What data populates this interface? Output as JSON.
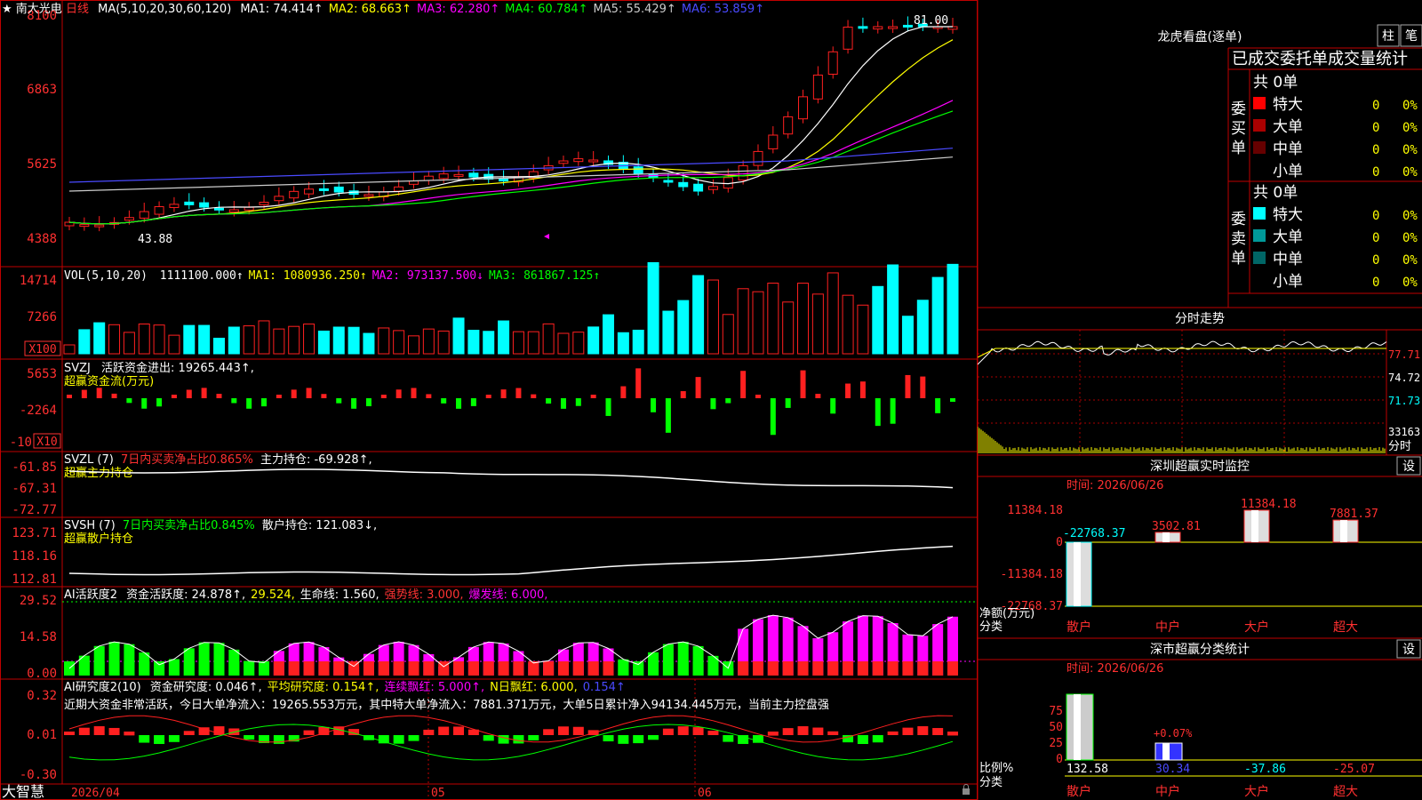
{
  "stock": {
    "star": "★",
    "name": "南大光电",
    "period": "日线"
  },
  "ma_line": {
    "label": "MA(5,10,20,30,60,120)",
    "items": [
      {
        "text": "MA1: 74.414",
        "arrow": "↑",
        "color": "#ffffff"
      },
      {
        "text": "MA2: 68.663",
        "arrow": "↑",
        "color": "#ffff00"
      },
      {
        "text": "MA3: 62.280",
        "arrow": "↑",
        "color": "#ff00ff"
      },
      {
        "text": "MA4: 60.784",
        "arrow": "↑",
        "color": "#00ff00"
      },
      {
        "text": "MA5: 55.429",
        "arrow": "↑",
        "color": "#cccccc"
      },
      {
        "text": "MA6: 53.859",
        "arrow": "↑",
        "color": "#4a4aff"
      }
    ]
  },
  "price_axis": [
    "8100",
    "6863",
    "5625",
    "4388"
  ],
  "price_annotations": {
    "high": "81.00",
    "low": "43.88"
  },
  "vol": {
    "label": "VOL(5,10,20)",
    "items": [
      {
        "text": "1111100.000",
        "arrow": "↑",
        "color": "#ffffff"
      },
      {
        "text": "MA1: 1080936.250",
        "arrow": "↑",
        "color": "#ffff00"
      },
      {
        "text": "MA2: 973137.500",
        "arrow": "↓",
        "color": "#ff00ff"
      },
      {
        "text": "MA3: 861867.125",
        "arrow": "↑",
        "color": "#00ff00"
      }
    ],
    "axis": [
      "14714",
      "7266"
    ],
    "unit": "X100"
  },
  "svzj": {
    "name": "SVZJ",
    "text": "活跃资金进出: 19265.443↑,",
    "sub": "超赢资金流(万元)",
    "axis": [
      "5653",
      "-2264",
      "-10"
    ],
    "unit": "X10"
  },
  "svzl": {
    "name": "SVZL (7)",
    "ratio": "7日内买卖净占比0.865%",
    "hold": "主力持仓: -69.928↑,",
    "sub": "超赢主力持仓",
    "axis": [
      "-61.85",
      "-67.31",
      "-72.77"
    ]
  },
  "svsh": {
    "name": "SVSH (7)",
    "ratio": "7日内买卖净占比0.845%",
    "hold": "散户持仓: 121.083↓,",
    "sub": "超赢散户持仓",
    "axis": [
      "123.71",
      "118.16",
      "112.81"
    ]
  },
  "ai1": {
    "name": "AI活跃度2",
    "items": [
      {
        "text": "资金活跃度: 24.878↑,",
        "color": "#ffffff"
      },
      {
        "text": "29.524,",
        "color": "#ffff00"
      },
      {
        "text": "生命线: 1.560,",
        "color": "#ffffff"
      },
      {
        "text": "强势线: 3.000,",
        "color": "#ff3333"
      },
      {
        "text": "爆发线: 6.000,",
        "color": "#ff00ff"
      }
    ],
    "axis": [
      "29.52",
      "14.58",
      "0.00"
    ]
  },
  "ai2": {
    "name": "AI研究度2(10)",
    "items": [
      {
        "text": "资金研究度: 0.046↑,",
        "color": "#ffffff"
      },
      {
        "text": "平均研究度: 0.154↑,",
        "color": "#ffff00"
      },
      {
        "text": "连续飘红: 5.000↑,",
        "color": "#ff00ff"
      },
      {
        "text": "N日飘红: 6.000,",
        "color": "#ffff00"
      },
      {
        "text": "0.154↑",
        "color": "#4a4aff"
      }
    ],
    "comment": "近期大资金非常活跃，今日大单净流入：19265.553万元，其中特大单净流入：7881.371万元，大单5日累计净入94134.445万元，当前主力控盘强",
    "axis": [
      "0.32",
      "0.01",
      "-0.30"
    ]
  },
  "date_axis": [
    "2026/04",
    "05",
    "06"
  ],
  "brand": "大智慧",
  "longhu": {
    "title": "龙虎看盘(逐单)",
    "btn1": "柱",
    "btn2": "笔",
    "tabs": "已成交委托单成交量统计",
    "buy_label": "委买单",
    "sell_label": "委卖单",
    "buy_total": "共 0单",
    "sell_total": "共 0单",
    "buy_rows": [
      {
        "label": "特大",
        "count": "0",
        "pct": "0%",
        "color": "#ff0000"
      },
      {
        "label": "大单",
        "count": "0",
        "pct": "0%",
        "color": "#aa0000"
      },
      {
        "label": "中单",
        "count": "0",
        "pct": "0%",
        "color": "#660000"
      },
      {
        "label": "小单",
        "count": "0",
        "pct": "0%",
        "color": ""
      }
    ],
    "sell_rows": [
      {
        "label": "特大",
        "count": "0",
        "pct": "0%",
        "color": "#00ffff"
      },
      {
        "label": "大单",
        "count": "0",
        "pct": "0%",
        "color": "#009999"
      },
      {
        "label": "中单",
        "count": "0",
        "pct": "0%",
        "color": "#006666"
      },
      {
        "label": "小单",
        "count": "0",
        "pct": "0%",
        "color": ""
      }
    ]
  },
  "fenshi": {
    "title": "分时走势",
    "axis": [
      "77.71",
      "74.72",
      "71.73"
    ],
    "vol_label": "33163",
    "vol_unit": "分时"
  },
  "monitor": {
    "title": "深圳超赢实时监控",
    "btn": "设",
    "time": "时间: 2026/06/26",
    "axis": [
      "11384.18",
      "0",
      "-11384.18",
      "-22768.37"
    ],
    "values": [
      "-22768.37",
      "3502.81",
      "11384.18",
      "7881.37"
    ],
    "series": [
      -22768.37,
      3502.81,
      11384.18,
      7881.37
    ],
    "ylabel": "净额(万元)",
    "xlabel": "分类",
    "categories": [
      "散户",
      "中户",
      "大户",
      "超大"
    ]
  },
  "classify": {
    "title": "深市超赢分类统计",
    "btn": "设",
    "time": "时间: 2026/06/26",
    "axis": [
      "75",
      "50",
      "25",
      "0"
    ],
    "bar_label": "+0.07%",
    "values": [
      "132.58",
      "30.34",
      "-37.86",
      "-25.07"
    ],
    "ylabel": "比例%",
    "xlabel": "分类",
    "categories": [
      "散户",
      "中户",
      "大户",
      "超大"
    ]
  },
  "colors": {
    "up": "#ff2020",
    "down": "#00ffff",
    "grid": "#aa0000",
    "axis": "#ff3030",
    "yellow": "#ffff00"
  }
}
